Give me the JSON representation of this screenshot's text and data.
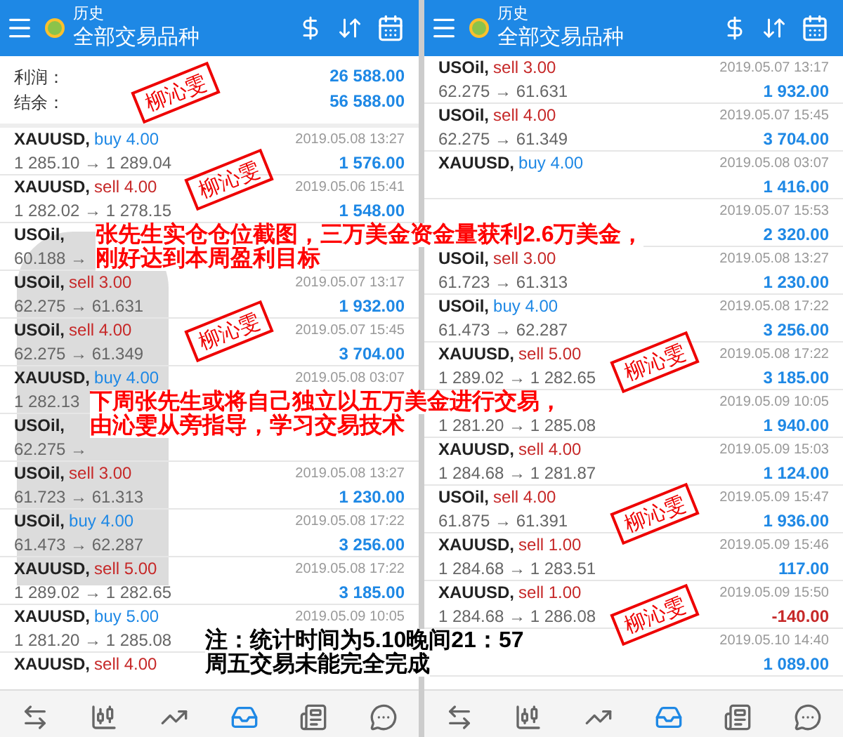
{
  "panels": [
    {
      "header": {
        "subtitle": "历史",
        "title": "全部交易品种"
      },
      "summary": [
        {
          "label": "利润：",
          "value": "26 588.00"
        },
        {
          "label": "结余：",
          "value": "56 588.00"
        }
      ],
      "trades": [
        {
          "symbol": "XAUUSD,",
          "order": "buy 4.00",
          "kind": "buy",
          "prices": "1 285.10 → 1 289.04",
          "time": "2019.05.08 13:27",
          "profit": "1 576.00",
          "negative": false
        },
        {
          "symbol": "XAUUSD,",
          "order": "sell 4.00",
          "kind": "sell",
          "prices": "1 282.02 → 1 278.15",
          "time": "2019.05.06 15:41",
          "profit": "1 548.00",
          "negative": false
        },
        {
          "symbol": "USOil,",
          "prices": "60.188 →"
        },
        {
          "symbol": "USOil,",
          "order": "sell 3.00",
          "kind": "sell",
          "prices": "62.275 → 61.631",
          "time": "2019.05.07 13:17",
          "profit": "1 932.00",
          "negative": false
        },
        {
          "symbol": "USOil,",
          "order": "sell 4.00",
          "kind": "sell",
          "prices": "62.275 → 61.349",
          "time": "2019.05.07 15:45",
          "profit": "3 704.00",
          "negative": false
        },
        {
          "symbol": "XAUUSD,",
          "order": "buy 4.00",
          "kind": "buy",
          "prices": "1 282.13",
          "time": "2019.05.08 03:07"
        },
        {
          "symbol": "USOil,",
          "prices": "62.275 →"
        },
        {
          "symbol": "USOil,",
          "order": "sell 3.00",
          "kind": "sell",
          "prices": "61.723 → 61.313",
          "time": "2019.05.08 13:27",
          "profit": "1 230.00",
          "negative": false
        },
        {
          "symbol": "USOil,",
          "order": "buy 4.00",
          "kind": "buy",
          "prices": "61.473 → 62.287",
          "time": "2019.05.08 17:22",
          "profit": "3 256.00",
          "negative": false
        },
        {
          "symbol": "XAUUSD,",
          "order": "sell 5.00",
          "kind": "sell",
          "prices": "1 289.02 → 1 282.65",
          "time": "2019.05.08 17:22",
          "profit": "3 185.00",
          "negative": false
        },
        {
          "symbol": "XAUUSD,",
          "order": "buy 5.00",
          "kind": "buy",
          "prices": "1 281.20 → 1 285.08",
          "time": "2019.05.09 10:05"
        },
        {
          "symbol": "XAUUSD,",
          "order": "sell 4.00",
          "kind": "sell"
        }
      ],
      "nav": [
        {
          "kind": "quotes",
          "selected": false
        },
        {
          "kind": "chart",
          "selected": false
        },
        {
          "kind": "trade",
          "selected": false
        },
        {
          "kind": "history",
          "selected": true
        },
        {
          "kind": "news",
          "selected": false
        },
        {
          "kind": "chat",
          "selected": false
        }
      ]
    },
    {
      "header": {
        "subtitle": "历史",
        "title": "全部交易品种"
      },
      "trades": [
        {
          "symbol": "USOil,",
          "order": "sell 3.00",
          "kind": "sell",
          "prices": "62.275 → 61.631",
          "time": "2019.05.07 13:17",
          "profit": "1 932.00",
          "negative": false
        },
        {
          "symbol": "USOil,",
          "order": "sell 4.00",
          "kind": "sell",
          "prices": "62.275 → 61.349",
          "time": "2019.05.07 15:45",
          "profit": "3 704.00",
          "negative": false
        },
        {
          "symbol": "XAUUSD,",
          "order": "buy 4.00",
          "kind": "buy",
          "time": "2019.05.08 03:07",
          "profit": "1 416.00",
          "negative": false
        },
        {
          "time": "2019.05.07 15:53",
          "profit": "2 320.00",
          "negative": false
        },
        {
          "symbol": "USOil,",
          "order": "sell 3.00",
          "kind": "sell",
          "prices": "61.723 → 61.313",
          "time": "2019.05.08 13:27",
          "profit": "1 230.00",
          "negative": false
        },
        {
          "symbol": "USOil,",
          "order": "buy 4.00",
          "kind": "buy",
          "prices": "61.473 → 62.287",
          "time": "2019.05.08 17:22",
          "profit": "3 256.00",
          "negative": false
        },
        {
          "symbol": "XAUUSD,",
          "order": "sell 5.00",
          "kind": "sell",
          "prices": "1 289.02 → 1 282.65",
          "time": "2019.05.08 17:22",
          "profit": "3 185.00",
          "negative": false
        },
        {
          "prices": "1 281.20 → 1 285.08",
          "time": "2019.05.09 10:05",
          "profit": "1 940.00",
          "negative": false
        },
        {
          "symbol": "XAUUSD,",
          "order": "sell 4.00",
          "kind": "sell",
          "prices": "1 284.68 → 1 281.87",
          "time": "2019.05.09 15:03",
          "profit": "1 124.00",
          "negative": false
        },
        {
          "symbol": "USOil,",
          "order": "sell 4.00",
          "kind": "sell",
          "prices": "61.875 → 61.391",
          "time": "2019.05.09 15:47",
          "profit": "1 936.00",
          "negative": false
        },
        {
          "symbol": "XAUUSD,",
          "order": "sell 1.00",
          "kind": "sell",
          "prices": "1 284.68 → 1 283.51",
          "time": "2019.05.09 15:46",
          "profit": "117.00",
          "negative": false
        },
        {
          "symbol": "XAUUSD,",
          "order": "sell 1.00",
          "kind": "sell",
          "prices": "1 284.68 → 1 286.08",
          "time": "2019.05.09 15:50",
          "profit": "-140.00",
          "negative": true
        },
        {
          "time": "2019.05.10 14:40",
          "profit": "1 089.00",
          "negative": false
        }
      ],
      "nav": [
        {
          "kind": "quotes",
          "selected": false
        },
        {
          "kind": "chart",
          "selected": false
        },
        {
          "kind": "trade",
          "selected": false
        },
        {
          "kind": "history",
          "selected": true
        },
        {
          "kind": "news",
          "selected": false
        },
        {
          "kind": "chat",
          "selected": false
        }
      ]
    }
  ],
  "stamps": [
    "柳沁雯",
    "柳沁雯",
    "柳沁雯",
    "柳沁雯",
    "柳沁雯",
    "柳沁雯"
  ],
  "captions": [
    [
      "张先生实仓仓位截图，三万美金资金量获利2.6万美金，",
      "刚好达到本周盈利目标"
    ],
    [
      "下周张先生或将自己独立以五万美金进行交易，",
      "由沁雯从旁指导，学习交易技术"
    ]
  ],
  "note": [
    "注：统计时间为5.10晚间21：57",
    "周五交易未能完全完成"
  ]
}
